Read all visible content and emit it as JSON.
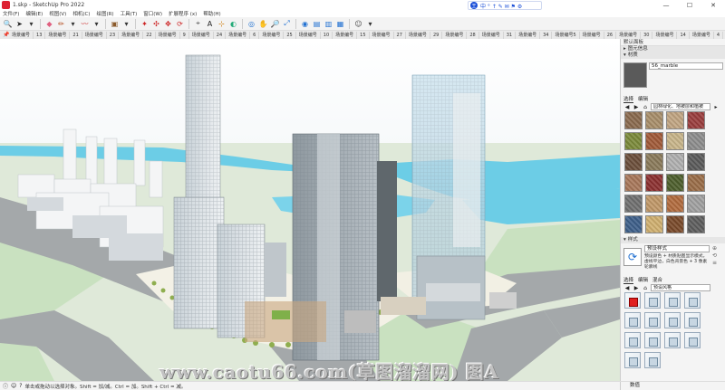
{
  "window": {
    "title": "1.skp - SketchUp Pro 2022",
    "minimize": "—",
    "maximize": "☐",
    "close": "✕"
  },
  "ime": {
    "badge": "王",
    "text": "中 ° ↑ ✎ ✉ ⚑ ⚙"
  },
  "menu": [
    "文件(F)",
    "编辑(E)",
    "视图(V)",
    "相机(C)",
    "绘图(R)",
    "工具(T)",
    "窗口(W)",
    "扩展程序 (x)",
    "帮助(H)"
  ],
  "toolbar": {
    "groups": [
      [
        {
          "icon": "magnify-icon",
          "glyph": "🔍",
          "color": "#3a6"
        },
        {
          "icon": "select-arrow-icon",
          "glyph": "➤",
          "color": "#222"
        },
        {
          "icon": "dropdown-icon",
          "glyph": "▾",
          "color": "#333"
        }
      ],
      [
        {
          "icon": "eraser-icon",
          "glyph": "◆",
          "color": "#e06080"
        },
        {
          "icon": "pencil-icon",
          "glyph": "✏",
          "color": "#b04010"
        },
        {
          "icon": "line-dropdown-icon",
          "glyph": "▾",
          "color": "#333"
        },
        {
          "icon": "freehand-icon",
          "glyph": "〰",
          "color": "#c33"
        },
        {
          "icon": "freehand-dropdown-icon",
          "glyph": "▾",
          "color": "#333"
        }
      ],
      [
        {
          "icon": "paint-bucket-icon",
          "glyph": "▣",
          "color": "#8b5a2b"
        },
        {
          "icon": "paint-dropdown-icon",
          "glyph": "▾",
          "color": "#333"
        }
      ],
      [
        {
          "icon": "push-pull-icon",
          "glyph": "✦",
          "color": "#c22"
        },
        {
          "icon": "offset-icon",
          "glyph": "✣",
          "color": "#c22"
        },
        {
          "icon": "move-icon",
          "glyph": "✥",
          "color": "#c22"
        },
        {
          "icon": "rotate-icon",
          "glyph": "⟳",
          "color": "#c22"
        }
      ],
      [
        {
          "icon": "tape-icon",
          "glyph": "⌖",
          "color": "#555"
        },
        {
          "icon": "text-icon",
          "glyph": "A",
          "color": "#222"
        },
        {
          "icon": "axes-icon",
          "glyph": "⊹",
          "color": "#c70"
        },
        {
          "icon": "section-icon",
          "glyph": "◐",
          "color": "#2a7"
        }
      ],
      [
        {
          "icon": "orbit-icon",
          "glyph": "◎",
          "color": "#1f6fd1"
        },
        {
          "icon": "pan-icon",
          "glyph": "✋",
          "color": "#c80"
        },
        {
          "icon": "zoom-icon",
          "glyph": "🔎",
          "color": "#1f6fd1"
        },
        {
          "icon": "zoom-extents-icon",
          "glyph": "⤢",
          "color": "#1f6fd1"
        }
      ],
      [
        {
          "icon": "warehouse-icon",
          "glyph": "◉",
          "color": "#1f6fd1"
        },
        {
          "icon": "extension-icon",
          "glyph": "▤",
          "color": "#1f6fd1"
        },
        {
          "icon": "layout-icon",
          "glyph": "▥",
          "color": "#1f6fd1"
        },
        {
          "icon": "style-builder-icon",
          "glyph": "▦",
          "color": "#1f6fd1"
        }
      ],
      [
        {
          "icon": "user-account-icon",
          "glyph": "☺",
          "color": "#444"
        },
        {
          "icon": "account-dropdown-icon",
          "glyph": "▾",
          "color": "#333"
        }
      ]
    ]
  },
  "scene_tabs": [
    "场景编号",
    "13",
    "场景编号",
    "21",
    "场景编号",
    "23",
    "场景编号",
    "22",
    "场景编号",
    "9",
    "场景编号",
    "24",
    "场景编号",
    "6",
    "场景编号",
    "25",
    "场景编号",
    "10",
    "场景编号",
    "15",
    "场景编号",
    "27",
    "场景编号",
    "29",
    "场景编号",
    "28",
    "场景编号",
    "31",
    "场景编号",
    "34",
    "场景编号5",
    "场景编号",
    "26",
    "场景编号",
    "30",
    "场景编号",
    "14",
    "场景编号",
    "4",
    "场景编号",
    "3",
    "场景编号4"
  ],
  "watermark": "www.caotu66.com(草图溜溜网) 图A",
  "status": {
    "hint": "单击或拖动以选择对象。Shift = 加/减。Ctrl = 加。Shift + Ctrl = 减。",
    "measure_label": "数值"
  },
  "tray": {
    "title": "默认面板",
    "entity_info": "图元信息",
    "materials": {
      "section": "材质",
      "name": "56_marble",
      "tabs": [
        "选择",
        "编辑"
      ],
      "library": "园林绿化、地被层和植被",
      "tiles": [
        "#8a6a4e",
        "#a88e6a",
        "#c1a582",
        "#9a3d3d",
        "#7b8a3a",
        "#a05a38",
        "#c8b58a",
        "#8d8d8d",
        "#6b4e3a",
        "#8a7a5a",
        "#b0b0b0",
        "#5a5a5a",
        "#a8775a",
        "#8c3030",
        "#4d5e2c",
        "#9a6d48",
        "#707070",
        "#c09868",
        "#b26b3e",
        "#a0a0a0",
        "#3e5f8a",
        "#d0b070",
        "#7a4a2a",
        "#5d5d5d"
      ]
    },
    "styles": {
      "section": "样式",
      "name": "预设样式",
      "description": "预设颜色 + 材质贴图显示模式，虚线平边，白色背景色 + 3 像素轮廓线",
      "tabs": [
        "选择",
        "编辑",
        "混合"
      ],
      "library": "预设风格",
      "cells": 14,
      "selected_index": 0
    }
  }
}
